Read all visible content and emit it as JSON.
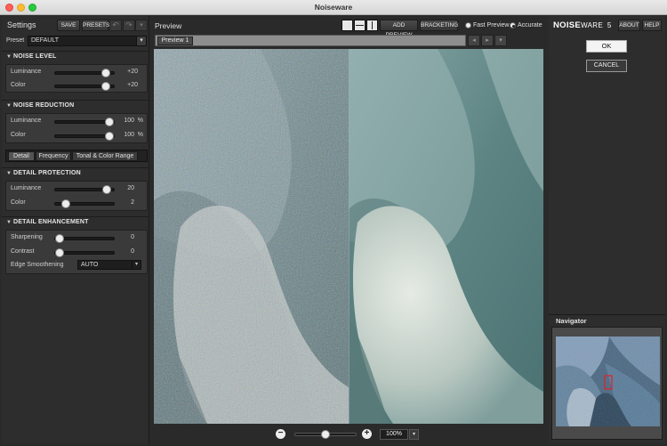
{
  "window": {
    "title": "Noiseware"
  },
  "settings": {
    "title": "Settings",
    "save_label": "SAVE",
    "presets_label": "PRESETS",
    "preset_label": "Preset",
    "preset_value": "DEFAULT",
    "noise_level": {
      "title": "NOISE LEVEL",
      "luminance": {
        "label": "Luminance",
        "value": "+20",
        "level": 0.92
      },
      "color": {
        "label": "Color",
        "value": "+20",
        "level": 0.92
      }
    },
    "noise_reduction": {
      "title": "NOISE REDUCTION",
      "luminance": {
        "label": "Luminance",
        "value": "100",
        "unit": "%",
        "level": 1.0
      },
      "color": {
        "label": "Color",
        "value": "100",
        "unit": "%",
        "level": 1.0
      }
    },
    "tabs": [
      "Detail",
      "Frequency",
      "Tonal & Color Range"
    ],
    "detail_protection": {
      "title": "DETAIL PROTECTION",
      "luminance": {
        "label": "Luminance",
        "value": "20",
        "level": 0.95
      },
      "color": {
        "label": "Color",
        "value": "2",
        "level": 0.12
      }
    },
    "detail_enhancement": {
      "title": "DETAIL ENHANCEMENT",
      "sharpening": {
        "label": "Sharpening",
        "value": "0",
        "level": 0.0
      },
      "contrast": {
        "label": "Contrast",
        "value": "0",
        "level": 0.0
      },
      "edge_smoothening": {
        "label": "Edge Smoothening",
        "value": "AUTO"
      }
    }
  },
  "preview": {
    "title": "Preview",
    "add_preview_label": "ADD PREVIEW",
    "bracketing_label": "BRACKETING",
    "fast_preview_label": "Fast Preview",
    "accurate_label": "Accurate",
    "selected_mode": "Accurate",
    "tab_label": "Preview 1",
    "zoom_value": "100%",
    "zoom_level": 0.5
  },
  "brand": {
    "logo_main": "NOISE",
    "logo_thin": "WARE",
    "logo_version": "5",
    "about_label": "ABOUT",
    "help_label": "HELP",
    "ok_label": "OK",
    "cancel_label": "CANCEL",
    "navigator_label": "Navigator"
  },
  "colors": {
    "panel": "#2d2d2d",
    "accent_ok": "#f4f4f4",
    "navigator_marker": "#e0202a"
  },
  "icons": [
    "undo-icon",
    "redo-icon",
    "chevron-down-icon",
    "single-view-icon",
    "split-horizontal-icon",
    "split-vertical-icon",
    "chevron-left-icon",
    "chevron-right-icon",
    "zoom-out-icon",
    "zoom-in-icon"
  ]
}
